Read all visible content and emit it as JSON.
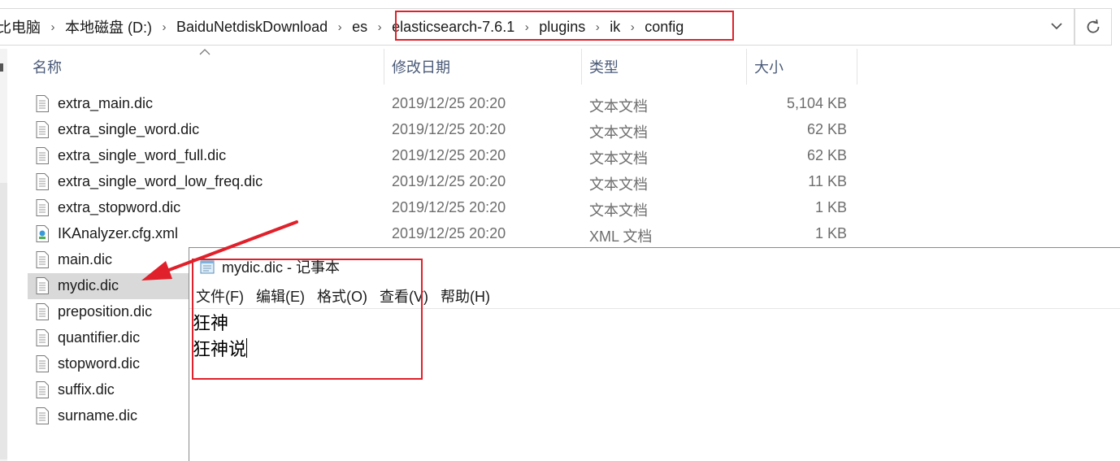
{
  "address_bar": {
    "crumbs": [
      "比电脑",
      "本地磁盘 (D:)",
      "BaiduNetdiskDownload",
      "es",
      "elasticsearch-7.6.1",
      "plugins",
      "ik",
      "config"
    ]
  },
  "columns": {
    "name": "名称",
    "modified": "修改日期",
    "type": "类型",
    "size": "大小"
  },
  "files": [
    {
      "name": "extra_main.dic",
      "date": "2019/12/25 20:20",
      "type": "文本文档",
      "size": "5,104 KB",
      "icon": "text-file-icon"
    },
    {
      "name": "extra_single_word.dic",
      "date": "2019/12/25 20:20",
      "type": "文本文档",
      "size": "62 KB",
      "icon": "text-file-icon"
    },
    {
      "name": "extra_single_word_full.dic",
      "date": "2019/12/25 20:20",
      "type": "文本文档",
      "size": "62 KB",
      "icon": "text-file-icon"
    },
    {
      "name": "extra_single_word_low_freq.dic",
      "date": "2019/12/25 20:20",
      "type": "文本文档",
      "size": "11 KB",
      "icon": "text-file-icon"
    },
    {
      "name": "extra_stopword.dic",
      "date": "2019/12/25 20:20",
      "type": "文本文档",
      "size": "1 KB",
      "icon": "text-file-icon"
    },
    {
      "name": "IKAnalyzer.cfg.xml",
      "date": "2019/12/25 20:20",
      "type": "XML 文档",
      "size": "1 KB",
      "icon": "xml-file-icon"
    },
    {
      "name": "main.dic",
      "date": "",
      "type": "",
      "size": "",
      "icon": "text-file-icon"
    },
    {
      "name": "mydic.dic",
      "date": "",
      "type": "",
      "size": "",
      "icon": "text-file-icon",
      "selected": true
    },
    {
      "name": "preposition.dic",
      "date": "",
      "type": "",
      "size": "",
      "icon": "text-file-icon"
    },
    {
      "name": "quantifier.dic",
      "date": "",
      "type": "",
      "size": "",
      "icon": "text-file-icon"
    },
    {
      "name": "stopword.dic",
      "date": "",
      "type": "",
      "size": "",
      "icon": "text-file-icon"
    },
    {
      "name": "suffix.dic",
      "date": "",
      "type": "",
      "size": "",
      "icon": "text-file-icon"
    },
    {
      "name": "surname.dic",
      "date": "",
      "type": "",
      "size": "",
      "icon": "text-file-icon"
    }
  ],
  "notepad": {
    "title": "mydic.dic - 记事本",
    "menu": [
      "文件(F)",
      "编辑(E)",
      "格式(O)",
      "查看(V)",
      "帮助(H)"
    ],
    "lines": [
      "狂神",
      "狂神说"
    ]
  },
  "colors": {
    "highlight_red": "#e0202a",
    "selected_row": "#d9d9d9",
    "header_text": "#4a5a78"
  }
}
